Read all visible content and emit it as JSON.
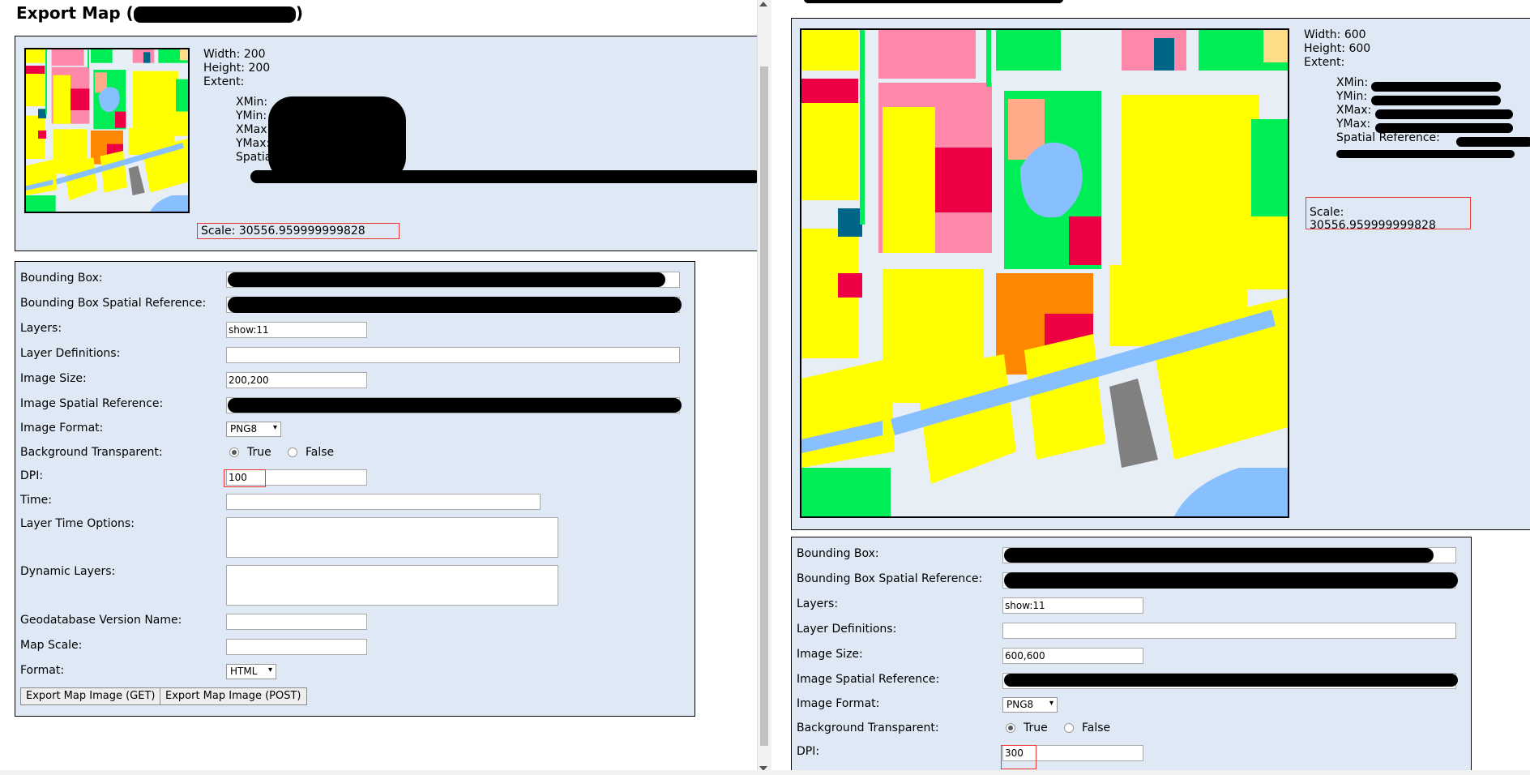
{
  "left": {
    "title": "Export Map (",
    "title_close": ")",
    "info": {
      "width": "Width: 200",
      "height": "Height: 200",
      "extent": "Extent:",
      "xmin": "XMin:",
      "ymin": "YMin:",
      "xmax": "XMax:",
      "ymax": "YMax:",
      "spatial": "Spatial Reference:"
    },
    "scale": "Scale: 30556.959999999828",
    "form": {
      "bbox_label": "Bounding Box:",
      "bbox_sr_label": "Bounding Box Spatial Reference:",
      "layers_label": "Layers:",
      "layers_value": "show:11",
      "layer_defs_label": "Layer Definitions:",
      "image_size_label": "Image Size:",
      "image_size_value": "200,200",
      "image_sr_label": "Image Spatial Reference:",
      "image_format_label": "Image Format:",
      "image_format_value": "PNG8",
      "bg_transparent_label": "Background Transparent:",
      "true_label": "True",
      "false_label": "False",
      "dpi_label": "DPI:",
      "dpi_value": "100",
      "time_label": "Time:",
      "layer_time_label": "Layer Time Options:",
      "dynamic_layers_label": "Dynamic Layers:",
      "gdb_version_label": "Geodatabase Version Name:",
      "map_scale_label": "Map Scale:",
      "format_label": "Format:",
      "format_value": "HTML",
      "get_button": "Export Map Image (GET)",
      "post_button": "Export Map Image (POST)"
    }
  },
  "right": {
    "info": {
      "width": "Width: 600",
      "height": "Height: 600",
      "extent": "Extent:",
      "xmin": "XMin:",
      "ymin": "YMin:",
      "xmax": "XMax:",
      "ymax": "YMax:",
      "spatial": "Spatial Reference:"
    },
    "scale": "Scale: 30556.959999999828",
    "form": {
      "bbox_label": "Bounding Box:",
      "bbox_sr_label": "Bounding Box Spatial Reference:",
      "layers_label": "Layers:",
      "layers_value": "show:11",
      "layer_defs_label": "Layer Definitions:",
      "image_size_label": "Image Size:",
      "image_size_value": "600,600",
      "image_sr_label": "Image Spatial Reference:",
      "image_format_label": "Image Format:",
      "image_format_value": "PNG8",
      "bg_transparent_label": "Background Transparent:",
      "true_label": "True",
      "false_label": "False",
      "dpi_label": "DPI:",
      "dpi_value": "300"
    }
  },
  "colors": {
    "panel_bg": "#dfe9f5",
    "highlight": "#ee3333",
    "map_yellow": "#ffff00",
    "map_green": "#00ee55",
    "map_pink": "#ff88aa",
    "map_red": "#ee0044",
    "map_orange": "#ff8800",
    "map_blue": "#88c0ff",
    "map_gray": "#808080",
    "map_road": "#e8eef5"
  }
}
